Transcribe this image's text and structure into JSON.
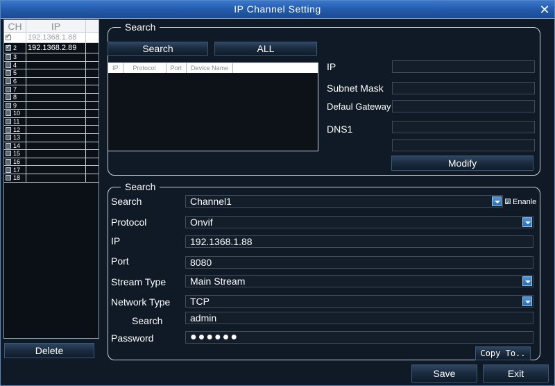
{
  "window": {
    "title": "IP Channel Setting"
  },
  "channel_list": {
    "headers": {
      "ch": "CH",
      "ip": "IP"
    },
    "rows": [
      {
        "ch": "",
        "ip": "192.1368.1.88",
        "checked": true
      },
      {
        "ch": "2",
        "ip": "192.1368.2.89",
        "checked": true
      },
      {
        "ch": "3",
        "ip": ""
      },
      {
        "ch": "4",
        "ip": ""
      },
      {
        "ch": "5",
        "ip": ""
      },
      {
        "ch": "6",
        "ip": ""
      },
      {
        "ch": "7",
        "ip": ""
      },
      {
        "ch": "8",
        "ip": ""
      },
      {
        "ch": "9",
        "ip": ""
      },
      {
        "ch": "10",
        "ip": ""
      },
      {
        "ch": "11",
        "ip": ""
      },
      {
        "ch": "12",
        "ip": ""
      },
      {
        "ch": "13",
        "ip": ""
      },
      {
        "ch": "14",
        "ip": ""
      },
      {
        "ch": "15",
        "ip": ""
      },
      {
        "ch": "16",
        "ip": ""
      },
      {
        "ch": "17",
        "ip": ""
      },
      {
        "ch": "18",
        "ip": ""
      }
    ]
  },
  "delete_label": "Delete",
  "search_group": {
    "legend": "Search",
    "search_button": "Search",
    "all_button": "ALL",
    "table_headers": [
      "IP",
      "Protocol",
      "Port",
      "Device Name"
    ],
    "ip_label": "IP",
    "subnet_label": "Subnet Mask",
    "gateway_label": "Defaul Gateway",
    "dns1_label": "DNS1",
    "modify_button": "Modify"
  },
  "config_group": {
    "legend": "Search",
    "search_label": "Search",
    "channel_value": "Channel1",
    "enable_label": "Enanle",
    "protocol_label": "Protocol",
    "protocol_value": "Onvif",
    "ip_label": "IP",
    "ip_value": "192.1368.1.88",
    "port_label": "Port",
    "port_value": "8080",
    "stream_label": "Stream Type",
    "stream_value": "Main Stream",
    "network_label": "Network Type",
    "network_value": "TCP",
    "user_label": "Search",
    "user_value": "admin",
    "password_label": "Password",
    "password_value": "●●●●●●",
    "copy_button": "Copy To.."
  },
  "footer": {
    "save": "Save",
    "exit": "Exit"
  }
}
